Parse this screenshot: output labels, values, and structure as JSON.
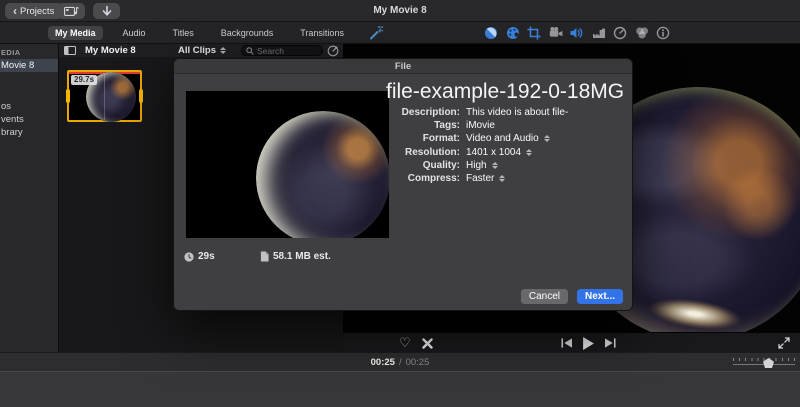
{
  "titlebar": {
    "back_label": "Projects",
    "window_title": "My Movie 8"
  },
  "tabs": {
    "items": [
      {
        "label": "My Media",
        "selected": true
      },
      {
        "label": "Audio",
        "selected": false
      },
      {
        "label": "Titles",
        "selected": false
      },
      {
        "label": "Backgrounds",
        "selected": false
      },
      {
        "label": "Transitions",
        "selected": false
      }
    ]
  },
  "viewer_toolbar": {
    "icons": [
      {
        "name": "color-balance-icon",
        "active": true
      },
      {
        "name": "color-correction-icon",
        "active": true
      },
      {
        "name": "crop-icon",
        "active": true
      },
      {
        "name": "stabilization-icon",
        "active": false
      },
      {
        "name": "volume-icon",
        "active": true
      },
      {
        "name": "noise-reduction-icon",
        "active": false
      },
      {
        "name": "speed-icon",
        "active": false
      },
      {
        "name": "clip-filter-icon",
        "active": false
      },
      {
        "name": "info-icon",
        "active": false
      }
    ]
  },
  "sidebar": {
    "section_label": "EDIA",
    "items": [
      {
        "label": "Movie 8",
        "selected": true
      },
      {
        "label": "os",
        "selected": false
      },
      {
        "label": "vents",
        "selected": false
      },
      {
        "label": "brary",
        "selected": false
      }
    ]
  },
  "browser": {
    "panel_title": "My Movie 8",
    "filter_label": "All Clips",
    "search_placeholder": "Search",
    "clip_duration_badge": "29.7s"
  },
  "dialog": {
    "window_title": "File",
    "headline": "file-example-192-0-18MG",
    "fields": [
      {
        "label": "Description:",
        "value": "This video is about file-",
        "has_stepper": false
      },
      {
        "label": "Tags:",
        "value": "iMovie",
        "has_stepper": false
      },
      {
        "label": "Format:",
        "value": "Video and Audio",
        "has_stepper": true
      },
      {
        "label": "Resolution:",
        "value": "1401 x 1004",
        "has_stepper": true
      },
      {
        "label": "Quality:",
        "value": "High",
        "has_stepper": true
      },
      {
        "label": "Compress:",
        "value": "Faster",
        "has_stepper": true
      }
    ],
    "duration": "29s",
    "size_estimate": "58.1 MB est.",
    "cancel_label": "Cancel",
    "next_label": "Next..."
  },
  "timeline": {
    "elapsed": "00:25",
    "separator": "/",
    "total": "00:25"
  },
  "colors": {
    "accent_blue": "#3273e8",
    "toolbar_icon_blue": "#3b82dd",
    "selection_yellow": "#eba700",
    "clip_top_strip_red": "#e03a2f"
  }
}
